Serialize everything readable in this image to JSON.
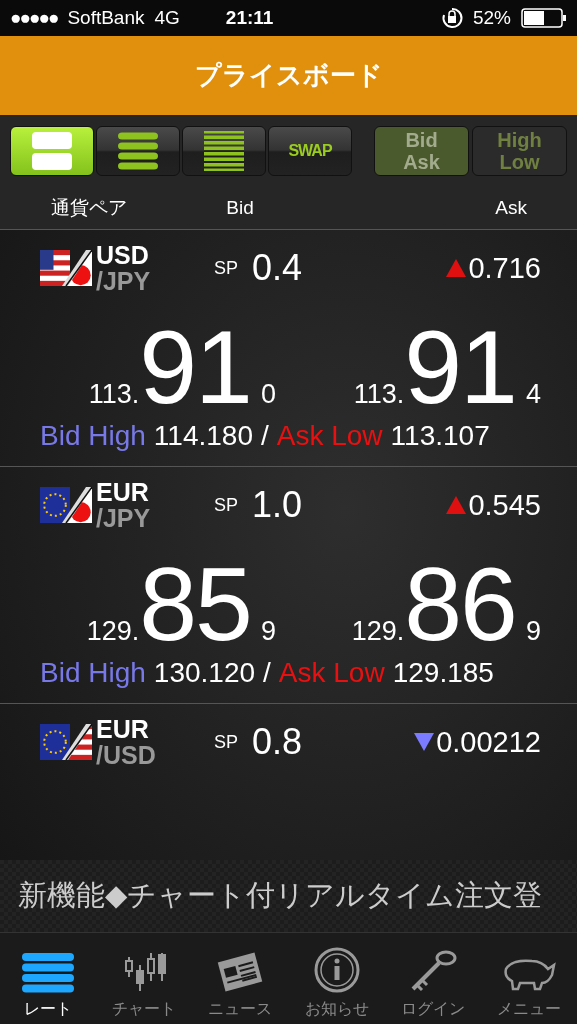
{
  "status_bar": {
    "signal_dots": "●●●●●",
    "carrier": "SoftBank",
    "network": "4G",
    "time": "21:11",
    "battery": "52%"
  },
  "header": {
    "title": "プライスボード"
  },
  "view_buttons": [
    {
      "kind": "rows2",
      "selected": true
    },
    {
      "kind": "rows4",
      "selected": false
    },
    {
      "kind": "rows8",
      "selected": false
    },
    {
      "kind": "text",
      "label": "SWAP",
      "selected": false
    }
  ],
  "display_buttons": [
    {
      "lines": [
        "Bid",
        "Ask"
      ],
      "selected": true
    },
    {
      "lines": [
        "High",
        "Low"
      ],
      "selected": false
    }
  ],
  "columns": [
    "通貨ペア",
    "Bid",
    "Ask"
  ],
  "rates": [
    {
      "base": "USD",
      "quote": "/JPY",
      "flags": [
        {
          "kind": "us"
        },
        {
          "kind": "jp"
        }
      ],
      "sp_label": "SP",
      "spread": "0.4",
      "change": {
        "kind": "up",
        "value": "0.716"
      },
      "bid": {
        "prefix": "113.",
        "main": "91",
        "suffix": "0"
      },
      "ask": {
        "prefix": "113.",
        "main": "91",
        "suffix": "4"
      },
      "high_label": "Bid High",
      "high": "114.180",
      "separator": "/",
      "low_label": "Ask Low",
      "low": "113.107"
    },
    {
      "base": "EUR",
      "quote": "/JPY",
      "flags": [
        {
          "kind": "eu"
        },
        {
          "kind": "jp"
        }
      ],
      "sp_label": "SP",
      "spread": "1.0",
      "change": {
        "kind": "up",
        "value": "0.545"
      },
      "bid": {
        "prefix": "129.",
        "main": "85",
        "suffix": "9"
      },
      "ask": {
        "prefix": "129.",
        "main": "86",
        "suffix": "9"
      },
      "high_label": "Bid High",
      "high": "130.120",
      "separator": "/",
      "low_label": "Ask Low",
      "low": "129.185"
    },
    {
      "base": "EUR",
      "quote": "/USD",
      "flags": [
        {
          "kind": "eu"
        },
        {
          "kind": "us"
        }
      ],
      "sp_label": "SP",
      "spread": "0.8",
      "change": {
        "kind": "down",
        "value": "0.00212"
      }
    }
  ],
  "ticker": {
    "text": "新機能◆チャート付リアルタイム注文登"
  },
  "tab_bar": [
    {
      "kind": "rate",
      "label": "レート",
      "selected": true
    },
    {
      "kind": "chart",
      "label": "チャート",
      "selected": false
    },
    {
      "kind": "news",
      "label": "ニュース",
      "selected": false
    },
    {
      "kind": "info",
      "label": "お知らせ",
      "selected": false
    },
    {
      "kind": "login",
      "label": "ログイン",
      "selected": false
    },
    {
      "kind": "menu",
      "label": "メニュー",
      "selected": false
    }
  ]
}
